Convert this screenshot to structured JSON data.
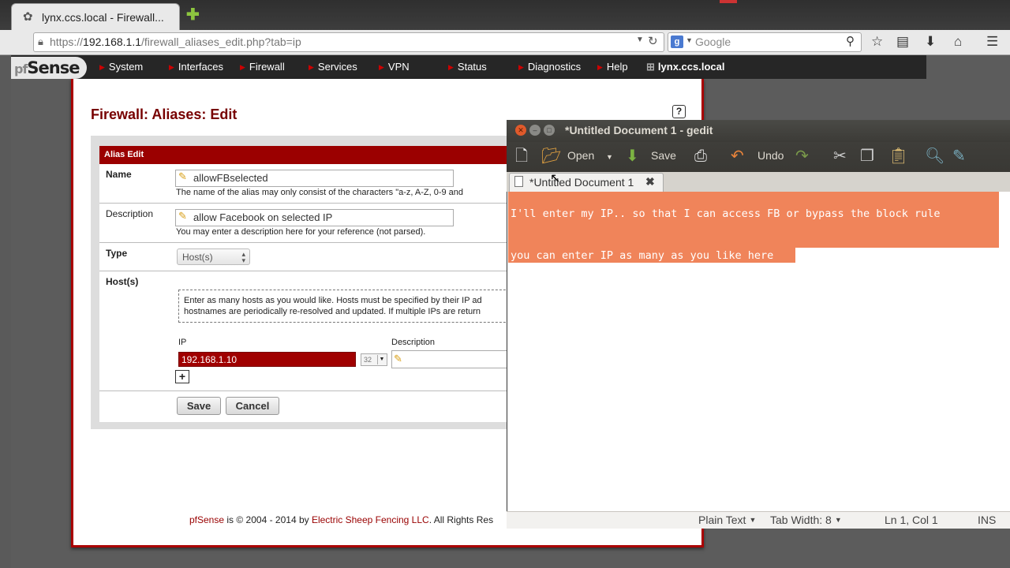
{
  "browser": {
    "tab_title": "lynx.ccs.local - Firewall...",
    "url_prefix": "https://",
    "url_host": "192.168.1.1",
    "url_path": "/firewall_aliases_edit.php?tab=ip",
    "search_engine": "g-icon",
    "search_placeholder": "Google"
  },
  "pfsense": {
    "logo_prefix": "pf",
    "logo_text": "Sense",
    "menu": [
      "System",
      "Interfaces",
      "Firewall",
      "Services",
      "VPN",
      "Status",
      "Diagnostics",
      "Help"
    ],
    "hostname": "lynx.ccs.local",
    "page_title": "Firewall: Aliases: Edit",
    "form": {
      "header": "Alias Edit",
      "name_label": "Name",
      "name_value": "allowFBselected",
      "name_hint": "The name of the alias may only consist of the characters \"a-z, A-Z, 0-9 and",
      "description_label": "Description",
      "description_value": "allow Facebook on selected IP",
      "description_hint": "You may enter a description here for your reference (not parsed).",
      "type_label": "Type",
      "type_value": "Host(s)",
      "hosts_label": "Host(s)",
      "hosts_info_line1": "Enter as many hosts as you would like. Hosts must be specified by their IP ad",
      "hosts_info_line2": "hostnames are periodically re-resolved and updated. If multiple IPs are return",
      "ip_column": "IP",
      "description_column": "Description",
      "ip_value": "192.168.1.10",
      "mask_value": "32",
      "save_label": "Save",
      "cancel_label": "Cancel"
    },
    "footer": {
      "brand": "pfSense",
      "text": " is © 2004 - 2014 by ",
      "company": "Electric Sheep Fencing LLC",
      "rights": ". All Rights Res"
    }
  },
  "gedit": {
    "window_title": "*Untitled Document 1 - gedit",
    "toolbar": {
      "open_label": "Open",
      "save_label": "Save",
      "undo_label": "Undo"
    },
    "tab_label": "*Untitled Document 1",
    "lines": [
      "I'll enter my IP.. so that I can access FB or bypass the block rule",
      "",
      "you can enter IP as many as you like here"
    ],
    "status": {
      "language": "Plain Text",
      "tab_width": "Tab Width:  8",
      "position": "Ln 1, Col 1",
      "mode": "INS"
    }
  }
}
